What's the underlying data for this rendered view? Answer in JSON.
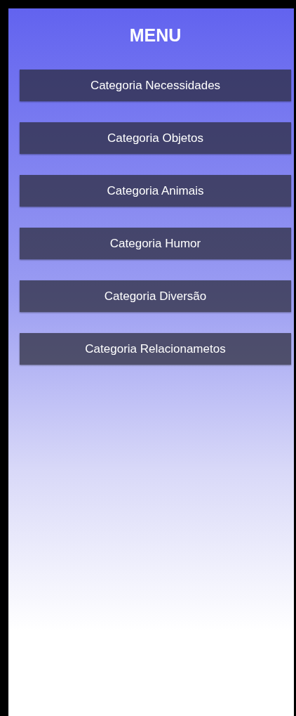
{
  "title": "MENU",
  "buttons": [
    {
      "label": "Categoria Necessidades"
    },
    {
      "label": "Categoria Objetos"
    },
    {
      "label": "Categoria Animais"
    },
    {
      "label": "Categoria Humor"
    },
    {
      "label": "Categoria Diversão"
    },
    {
      "label": "Categoria Relacionametos"
    }
  ]
}
